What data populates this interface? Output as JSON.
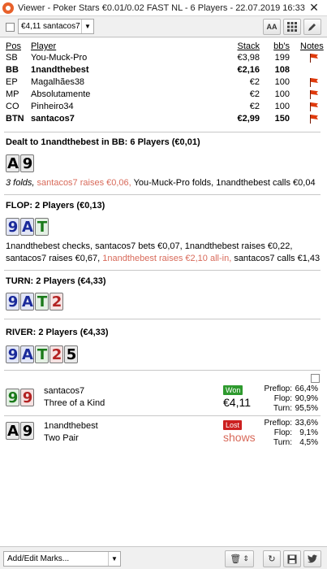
{
  "window": {
    "title": "Viewer - Poker Stars €0.01/0.02 FAST NL - 6 Players - 22.07.2019 16:33",
    "close": "✕"
  },
  "toolbar": {
    "player_select": "€4,11 santacos7",
    "font_button": "AA",
    "grid_button": "▦",
    "edit_button": "✎"
  },
  "table_headers": {
    "pos": "Pos",
    "player": "Player",
    "stack": "Stack",
    "bbs": "bb's",
    "notes": "Notes"
  },
  "players": [
    {
      "pos": "SB",
      "name": "You-Muck-Pro",
      "stack": "€3,98",
      "bbs": "199",
      "note_flag": true
    },
    {
      "pos": "BB",
      "name": "1nandthebest",
      "stack": "€2,16",
      "bbs": "108",
      "note_flag": false
    },
    {
      "pos": "EP",
      "name": "Magalhães38",
      "stack": "€2",
      "bbs": "100",
      "note_flag": true
    },
    {
      "pos": "MP",
      "name": "Absolutamente",
      "stack": "€2",
      "bbs": "100",
      "note_flag": true
    },
    {
      "pos": "CO",
      "name": "Pinheiro34",
      "stack": "€2",
      "bbs": "100",
      "note_flag": true
    },
    {
      "pos": "BTN",
      "name": "santacos7",
      "stack": "€2,99",
      "bbs": "150",
      "note_flag": true
    }
  ],
  "preflop": {
    "title": "Dealt to 1nandthebest in BB: 6 Players (€0,01)",
    "cards": [
      {
        "rank": "A",
        "suit": "s"
      },
      {
        "rank": "9",
        "suit": "s"
      }
    ],
    "action_folds": "3 folds,",
    "action_raise": "santacos7 raises €0,06,",
    "action_rest": "You-Muck-Pro folds, 1nandthebest calls €0,04"
  },
  "flop": {
    "title": "FLOP: 2 Players (€0,13)",
    "cards": [
      {
        "rank": "9",
        "suit": "d"
      },
      {
        "rank": "A",
        "suit": "d"
      },
      {
        "rank": "T",
        "suit": "c"
      }
    ],
    "action_1": "1nandthebest checks, santacos7 bets €0,07, 1nandthebest raises €0,22, santacos7 raises €0,67,",
    "action_red": "1nandthebest raises €2,10 all-in,",
    "action_2": "santacos7 calls €1,43"
  },
  "turn": {
    "title": "TURN: 2 Players (€4,33)",
    "cards": [
      {
        "rank": "9",
        "suit": "d"
      },
      {
        "rank": "A",
        "suit": "d"
      },
      {
        "rank": "T",
        "suit": "c"
      },
      {
        "rank": "2",
        "suit": "h"
      }
    ]
  },
  "river": {
    "title": "RIVER: 2 Players (€4,33)",
    "cards": [
      {
        "rank": "9",
        "suit": "d"
      },
      {
        "rank": "A",
        "suit": "d"
      },
      {
        "rank": "T",
        "suit": "c"
      },
      {
        "rank": "2",
        "suit": "h"
      },
      {
        "rank": "5",
        "suit": "s"
      }
    ]
  },
  "results": [
    {
      "cards": [
        {
          "rank": "9",
          "suit": "c"
        },
        {
          "rank": "9",
          "suit": "h"
        }
      ],
      "name": "santacos7",
      "hand": "Three of a Kind",
      "badge": "Won",
      "outcome": "€4,11",
      "stats": [
        {
          "label": "Preflop:",
          "value": "66,4%"
        },
        {
          "label": "Flop:",
          "value": "90,9%"
        },
        {
          "label": "Turn:",
          "value": "95,5%"
        }
      ]
    },
    {
      "cards": [
        {
          "rank": "A",
          "suit": "s"
        },
        {
          "rank": "9",
          "suit": "s"
        }
      ],
      "name": "1nandthebest",
      "hand": "Two Pair",
      "badge": "Lost",
      "outcome": "shows",
      "stats": [
        {
          "label": "Preflop:",
          "value": "33,6%"
        },
        {
          "label": "Flop:",
          "value": "9,1%"
        },
        {
          "label": "Turn:",
          "value": "4,5%"
        }
      ]
    }
  ],
  "bottom": {
    "marks_select": "Add/Edit Marks...",
    "delete_button": "🗑",
    "sort_button": "⇕",
    "replay_button": "↻",
    "save_button": "💾",
    "twitter_button": "🐦"
  }
}
